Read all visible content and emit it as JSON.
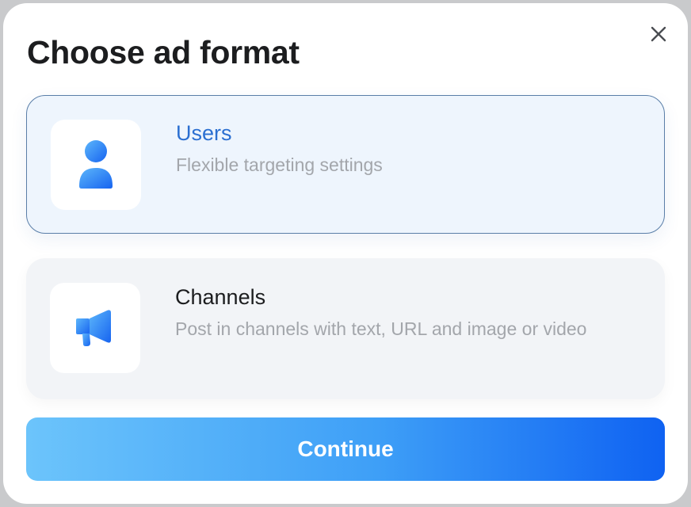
{
  "dialog": {
    "title": "Choose ad format"
  },
  "options": [
    {
      "title": "Users",
      "description": "Flexible targeting settings",
      "icon": "user-icon",
      "selected": true
    },
    {
      "title": "Channels",
      "description": "Post in channels with text, URL and image or video",
      "icon": "megaphone-icon",
      "selected": false
    }
  ],
  "actions": {
    "continue_label": "Continue"
  },
  "colors": {
    "accent": "#2b6fd1",
    "selected_bg": "#eef5fd",
    "unselected_bg": "#f2f4f7",
    "button_gradient_start": "#6cc4fb",
    "button_gradient_end": "#0f62f2"
  }
}
